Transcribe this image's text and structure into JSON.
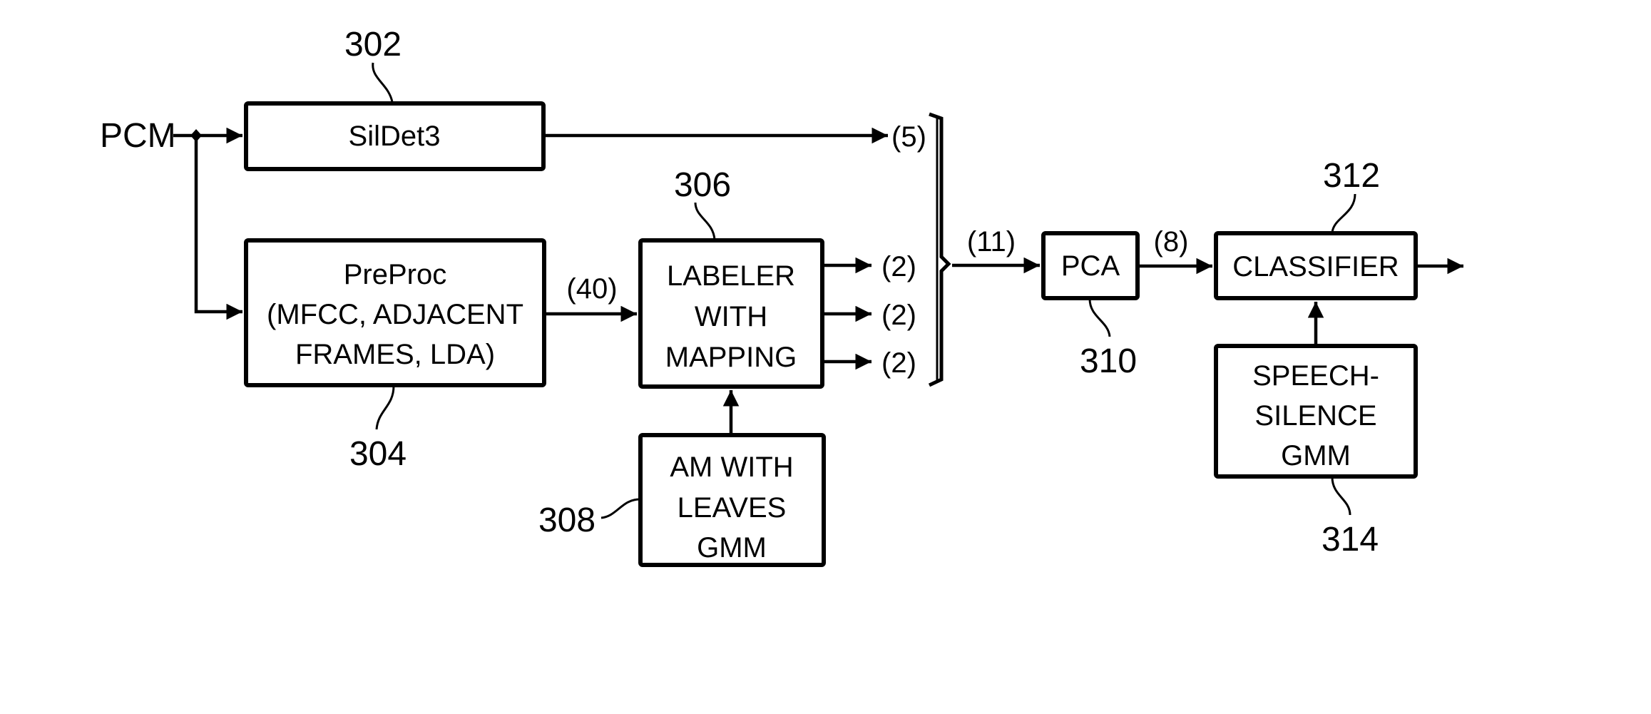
{
  "diagram": {
    "input_label": "PCM",
    "blocks": {
      "sildet": {
        "ref": "302",
        "lines": [
          "SilDet3"
        ]
      },
      "preproc": {
        "ref": "304",
        "lines": [
          "PreProc",
          "(MFCC, ADJACENT",
          "FRAMES, LDA)"
        ]
      },
      "labeler": {
        "ref": "306",
        "lines": [
          "LABELER",
          "WITH",
          "MAPPING"
        ]
      },
      "am": {
        "ref": "308",
        "lines": [
          "AM WITH",
          "LEAVES",
          "GMM"
        ]
      },
      "pca": {
        "ref": "310",
        "lines": [
          "PCA"
        ]
      },
      "classifier": {
        "ref": "312",
        "lines": [
          "CLASSIFIER"
        ]
      },
      "gmm": {
        "ref": "314",
        "lines": [
          "SPEECH-",
          "SILENCE",
          "GMM"
        ]
      }
    },
    "dimensions": {
      "sildet_out": "(5)",
      "preproc_out": "(40)",
      "labeler_out": [
        "(2)",
        "(2)",
        "(2)"
      ],
      "combined": "(11)",
      "pca_out": "(8)"
    }
  }
}
